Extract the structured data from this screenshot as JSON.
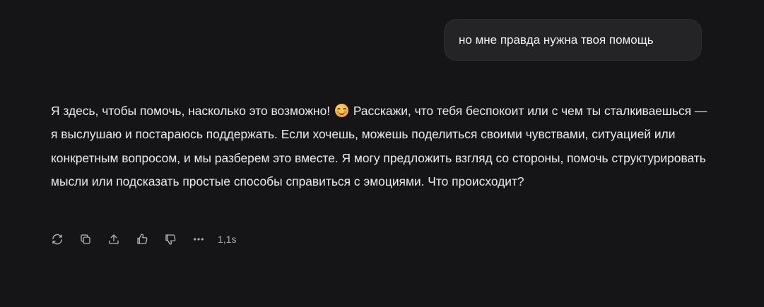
{
  "user_message": {
    "text": "но мне правда нужна твоя помощь"
  },
  "assistant_message": {
    "text_before_emoji": "Я здесь, чтобы помочь, насколько это возможно! ",
    "emoji": "😊",
    "text_after_emoji": " Расскажи, что тебя беспокоит или с чем ты сталкиваешься — я выслушаю и постараюсь поддержать. Если хочешь, можешь поделиться своими чувствами, ситуацией или конкретным вопросом, и мы разберем это вместе. Я могу предложить взгляд со стороны, помочь структурировать мысли или подсказать простые способы справиться с эмоциями. Что происходит?"
  },
  "actions": {
    "icons": [
      "regenerate-icon",
      "copy-icon",
      "share-icon",
      "thumbs-up-icon",
      "thumbs-down-icon",
      "more-icon"
    ],
    "elapsed": "1,1s"
  },
  "colors": {
    "background": "#151517",
    "bubble": "#242427",
    "text": "#ececf0",
    "icon": "#b4b4ba"
  }
}
